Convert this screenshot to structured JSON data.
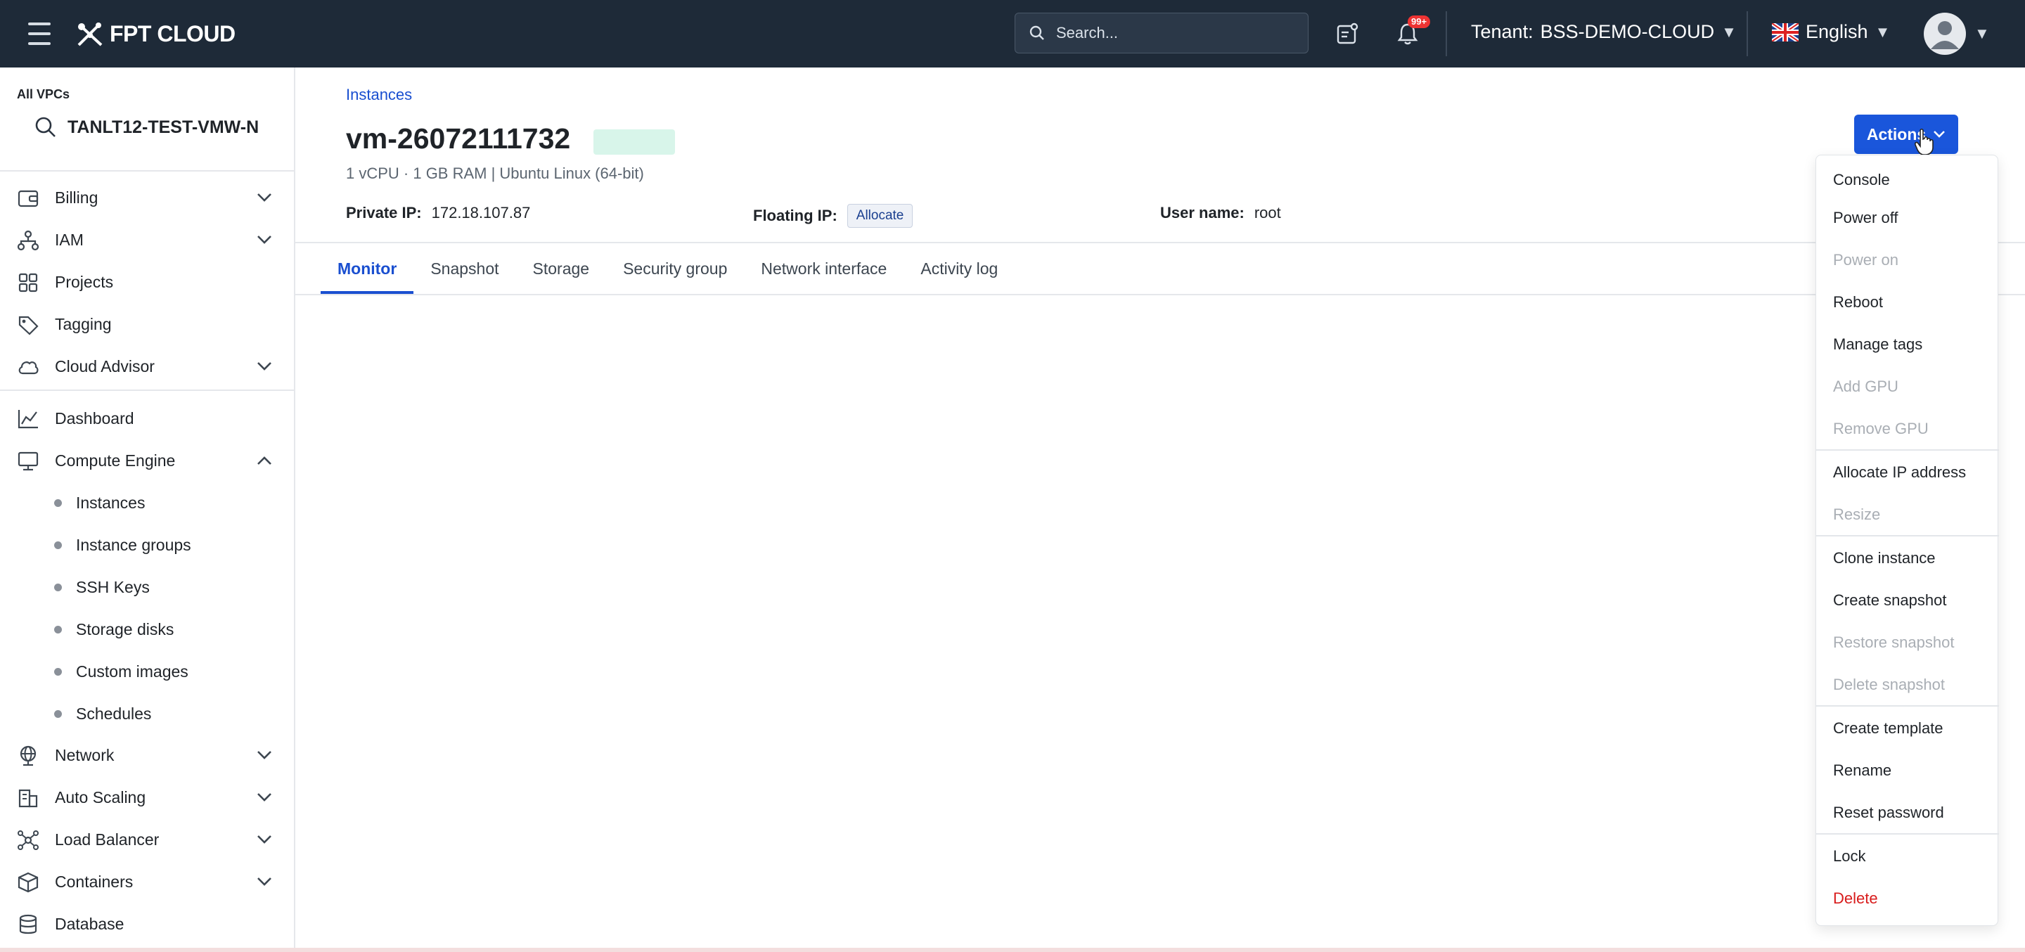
{
  "topbar": {
    "logo_text": "FPT CLOUD",
    "search_placeholder": "Search...",
    "notification_count": "99+",
    "tenant_label": "Tenant:",
    "tenant_value": "BSS-DEMO-CLOUD",
    "language": "English"
  },
  "sidebar": {
    "vpc_label": "All VPCs",
    "vpc_value": "TANLT12-TEST-VMW-N",
    "items": [
      {
        "label": "Billing"
      },
      {
        "label": "IAM"
      },
      {
        "label": "Projects"
      },
      {
        "label": "Tagging"
      },
      {
        "label": "Cloud Advisor"
      },
      {
        "label": "Dashboard"
      },
      {
        "label": "Compute Engine"
      },
      {
        "label": "Network"
      },
      {
        "label": "Auto Scaling"
      },
      {
        "label": "Load Balancer"
      },
      {
        "label": "Containers"
      },
      {
        "label": "Database"
      }
    ],
    "compute_sub": [
      {
        "label": "Instances"
      },
      {
        "label": "Instance groups"
      },
      {
        "label": "SSH Keys"
      },
      {
        "label": "Storage disks"
      },
      {
        "label": "Custom images"
      },
      {
        "label": "Schedules"
      }
    ]
  },
  "main": {
    "breadcrumb": "Instances",
    "vm_name": "vm-26072111732",
    "vm_specs": "1 vCPU · 1 GB RAM | Ubuntu Linux (64-bit)",
    "private_ip_label": "Private IP:",
    "private_ip_value": "172.18.107.87",
    "floating_ip_label": "Floating IP:",
    "floating_ip_action": "Allocate",
    "username_label": "User name:",
    "username_value": "root",
    "tabs": [
      {
        "label": "Monitor"
      },
      {
        "label": "Snapshot"
      },
      {
        "label": "Storage"
      },
      {
        "label": "Security group"
      },
      {
        "label": "Network interface"
      },
      {
        "label": "Activity log"
      }
    ]
  },
  "actions": {
    "button_label": "Actions",
    "menu": [
      {
        "label": "Console",
        "state": "enabled"
      },
      {
        "label": "Power off",
        "state": "enabled"
      },
      {
        "label": "Power on",
        "state": "disabled"
      },
      {
        "label": "Reboot",
        "state": "enabled"
      },
      {
        "label": "Manage tags",
        "state": "enabled"
      },
      {
        "label": "Add GPU",
        "state": "disabled"
      },
      {
        "label": "Remove GPU",
        "state": "disabled"
      },
      {
        "label": "Allocate IP address",
        "state": "enabled"
      },
      {
        "label": "Resize",
        "state": "disabled"
      },
      {
        "label": "Clone instance",
        "state": "enabled"
      },
      {
        "label": "Create snapshot",
        "state": "enabled"
      },
      {
        "label": "Restore snapshot",
        "state": "disabled"
      },
      {
        "label": "Delete snapshot",
        "state": "disabled"
      },
      {
        "label": "Create template",
        "state": "enabled"
      },
      {
        "label": "Rename",
        "state": "enabled"
      },
      {
        "label": "Reset password",
        "state": "enabled"
      },
      {
        "label": "Lock",
        "state": "enabled"
      },
      {
        "label": "Delete",
        "state": "danger"
      }
    ]
  },
  "colors": {
    "topbar_bg": "#1e2a38",
    "accent": "#1a56db",
    "status_pill": "#d8f5ea",
    "danger": "#d81b1b"
  }
}
